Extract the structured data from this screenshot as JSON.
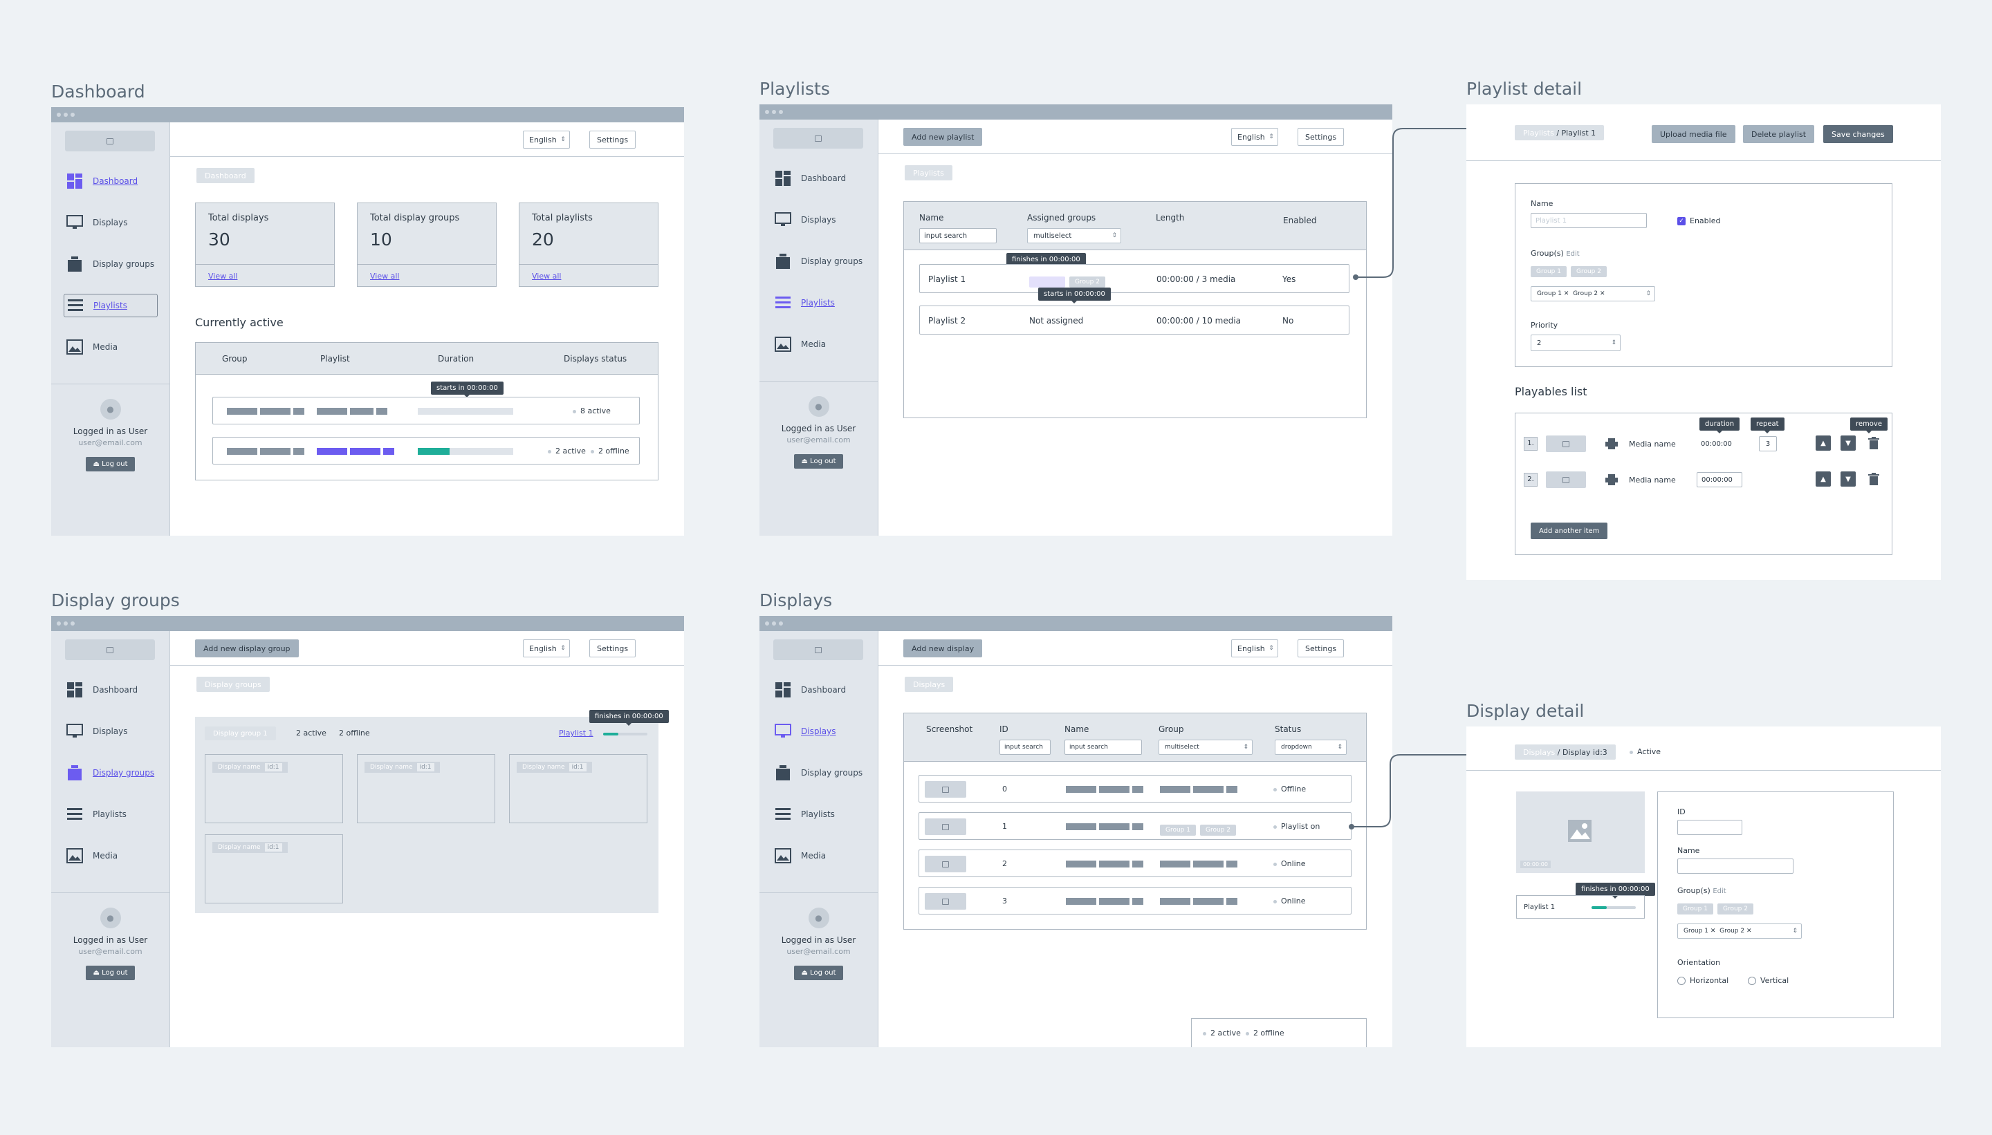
{
  "common": {
    "language": "English",
    "settings": "Settings",
    "logged_in": "Logged in as User",
    "email": "user@email.com",
    "logout": "Log out",
    "nav": [
      "Dashboard",
      "Displays",
      "Display groups",
      "Playlists",
      "Media"
    ]
  },
  "dashboard": {
    "title": "Dashboard",
    "crumb": "Dashboard",
    "stats": [
      {
        "label": "Total displays",
        "value": "30",
        "link": "View all"
      },
      {
        "label": "Total display groups",
        "value": "10",
        "link": "View all"
      },
      {
        "label": "Total playlists",
        "value": "20",
        "link": "View all"
      }
    ],
    "currently_active": "Currently active",
    "columns": [
      "Group",
      "Playlist",
      "Duration",
      "Displays status"
    ],
    "tooltip": "starts in 00:00:00",
    "row1_status": "8 active",
    "row2_active": "2 active",
    "row2_offline": "2 offline",
    "progress_row2": 0.33,
    "colors": {
      "accent": "#6c5cf0",
      "progress": "#1fae99"
    }
  },
  "playlists": {
    "title": "Playlists",
    "add": "Add new playlist",
    "crumb": "Playlists",
    "columns": [
      "Name",
      "Assigned groups",
      "Length",
      "Enabled"
    ],
    "name_placeholder": "input search",
    "group_placeholder": "multiselect",
    "rows": [
      {
        "name": "Playlist 1",
        "groups": [
          "Group 1",
          "Group 2"
        ],
        "length": "00:00:00 / 3 media",
        "enabled": "Yes"
      },
      {
        "name": "Playlist 2",
        "groups": "Not assigned",
        "length": "00:00:00 / 10 media",
        "enabled": "No"
      }
    ],
    "tip_finishes": "finishes in 00:00:00",
    "tip_starts": "starts in 00:00:00"
  },
  "playlist_detail": {
    "title": "Playlist detail",
    "crumb_root": "Playlists",
    "crumb_current": "/ Playlist 1",
    "upload": "Upload media file",
    "delete": "Delete playlist",
    "save": "Save changes",
    "name_label": "Name",
    "name_value": "Playlist 1",
    "enabled": "Enabled",
    "groups_label": "Group(s)",
    "edit": "Edit",
    "groups": [
      "Group 1",
      "Group 2"
    ],
    "priority_label": "Priority",
    "priority_value": "2",
    "playables_title": "Playables list",
    "items": [
      {
        "index": "1.",
        "name": "Media name",
        "duration": "00:00:00",
        "repeat": "3"
      },
      {
        "index": "2.",
        "name": "Media name",
        "duration": "00:00:00"
      }
    ],
    "tip_duration": "duration",
    "tip_repeat": "repeat",
    "tip_remove": "remove",
    "add_item": "Add another item"
  },
  "display_groups": {
    "title": "Display groups",
    "add": "Add new display group",
    "crumb": "Display groups",
    "group_name": "Display group 1",
    "active": "2 active",
    "offline": "2 offline",
    "playlist_link": "Playlist 1",
    "tip": "finishes in 00:00:00",
    "progress": 0.35,
    "card_name": "Display name",
    "card_id": "id:1"
  },
  "displays": {
    "title": "Displays",
    "add": "Add new display",
    "crumb": "Displays",
    "columns": [
      "Screenshot",
      "ID",
      "Name",
      "Group",
      "Status"
    ],
    "id_placeholder": "input search",
    "name_placeholder": "input search",
    "group_placeholder": "multiselect",
    "status_placeholder": "dropdown",
    "rows": [
      {
        "id": "0",
        "status": "Offline"
      },
      {
        "id": "1",
        "status": "Playlist on",
        "groups": [
          "Group 1",
          "Group 2"
        ]
      },
      {
        "id": "2",
        "status": "Online"
      },
      {
        "id": "3",
        "status": "Online"
      }
    ],
    "footer_active": "2 active",
    "footer_offline": "2 offline"
  },
  "display_detail": {
    "title": "Display detail",
    "crumb_root": "Displays",
    "crumb_current": "/ Display id:3",
    "status": "Active",
    "shot_caption": "00:00:00",
    "playlist": "Playlist 1",
    "tip": "finishes in 00:00:00",
    "progress": 0.35,
    "id_label": "ID",
    "name_label": "Name",
    "groups_label": "Group(s)",
    "edit": "Edit",
    "groups": [
      "Group 1",
      "Group 2"
    ],
    "orientation_label": "Orientation",
    "horizontal": "Horizontal",
    "vertical": "Vertical"
  }
}
